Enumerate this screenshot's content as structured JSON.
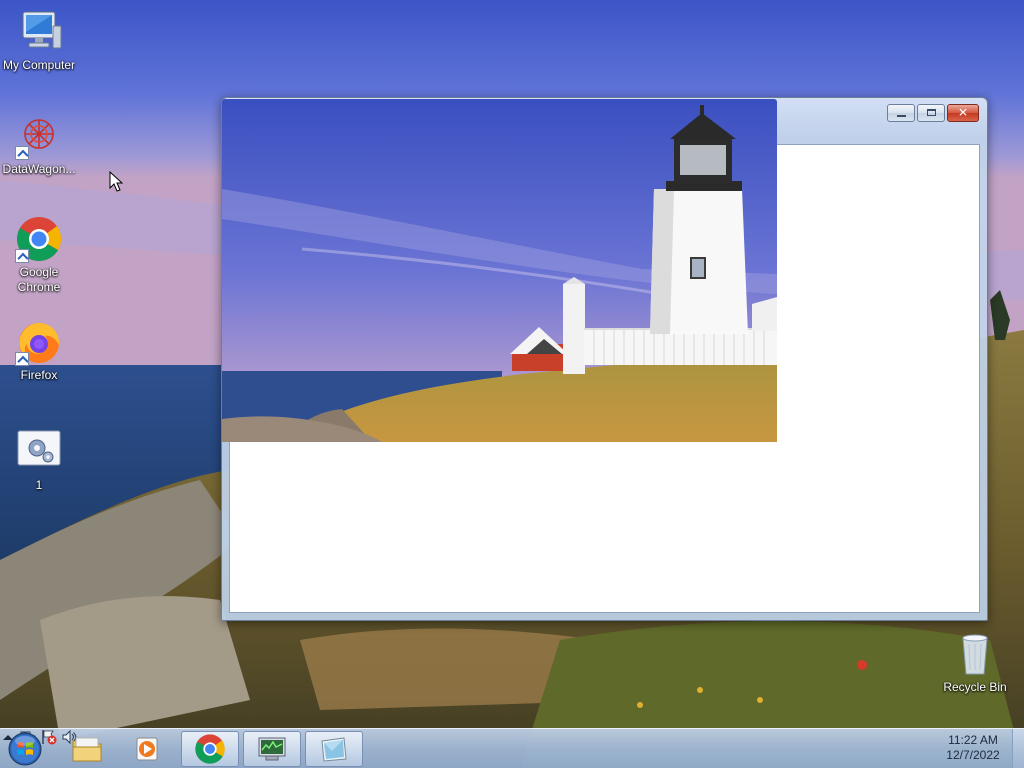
{
  "desktop": {
    "icons": [
      {
        "label": "My Computer",
        "icon": "computer-icon"
      },
      {
        "label": "DataWagon...",
        "icon": "datawagon-icon"
      },
      {
        "label": "Google Chrome",
        "icon": "chrome-icon"
      },
      {
        "label": "Firefox",
        "icon": "firefox-icon"
      },
      {
        "label": "1",
        "icon": "settings-app-icon"
      },
      {
        "label": "Recycle Bin",
        "icon": "recycle-bin-icon"
      }
    ]
  },
  "window": {
    "caption_buttons": {
      "minimize": "minimize-icon",
      "maximize": "maximize-icon",
      "close": "close-icon"
    }
  },
  "taskbar": {
    "start": "windows-start-icon",
    "pinned": [
      {
        "icon": "file-explorer-icon"
      },
      {
        "icon": "media-player-icon"
      },
      {
        "icon": "chrome-icon",
        "active": true
      },
      {
        "icon": "network-monitor-icon",
        "active": true
      },
      {
        "icon": "notepad-window-icon",
        "active": true
      }
    ],
    "tray": {
      "icons": [
        "show-hidden-icons-chevron-icon",
        "network-icon",
        "action-center-flag-icon",
        "volume-icon"
      ],
      "time": "11:22 AM",
      "date": "12/7/2022"
    }
  },
  "colors": {
    "accent": "#2a5fbf",
    "close_red": "#c43a22",
    "taskbar": "#a0b8d6"
  }
}
